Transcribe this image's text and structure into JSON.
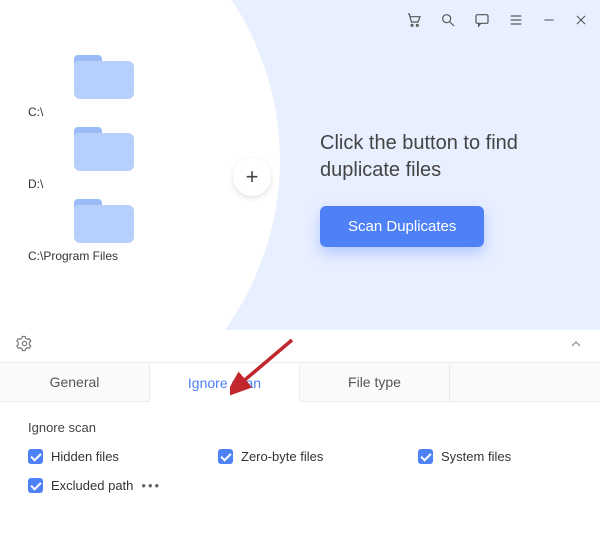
{
  "titlebar": {
    "icons": [
      "cart-icon",
      "search-icon",
      "feedback-icon",
      "menu-icon",
      "minimize-icon",
      "close-icon"
    ]
  },
  "folders": [
    {
      "label": "C:\\"
    },
    {
      "label": "D:\\"
    },
    {
      "label": "C:\\Program Files"
    }
  ],
  "add_button": "+",
  "right": {
    "heading": "Click the button to find duplicate files",
    "scan_label": "Scan Duplicates"
  },
  "tabs": {
    "general": "General",
    "ignore": "Ignore scan",
    "filetype": "File type",
    "active": "ignore"
  },
  "settings": {
    "title": "Ignore scan",
    "hidden": "Hidden files",
    "zero": "Zero-byte files",
    "system": "System files",
    "excluded": "Excluded path",
    "more": "•••"
  }
}
